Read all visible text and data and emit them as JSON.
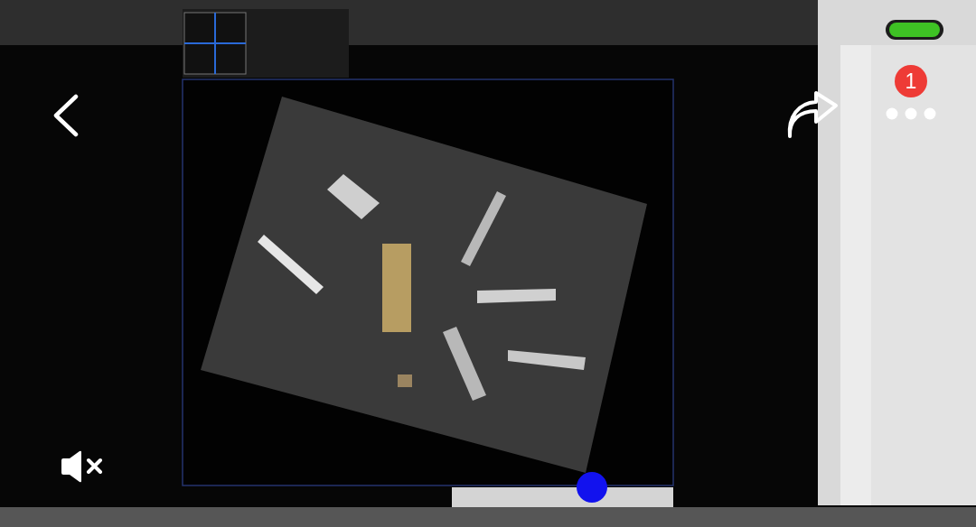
{
  "player": {
    "muted": true
  },
  "notification_badge": {
    "count": "1"
  }
}
